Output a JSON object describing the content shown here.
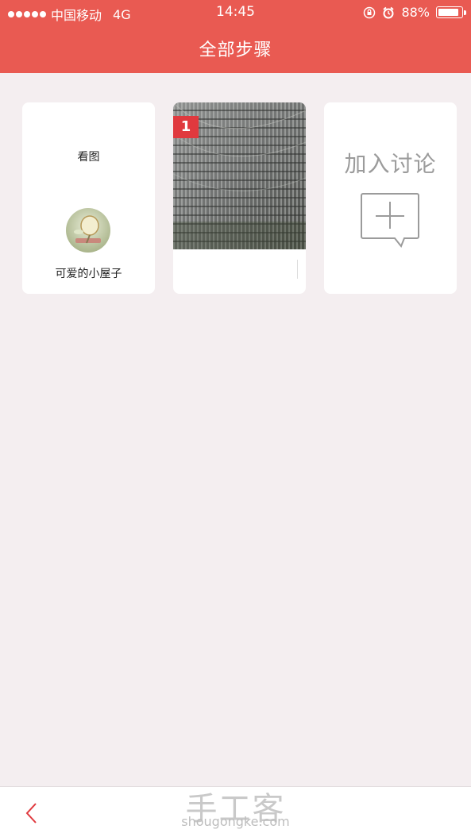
{
  "status_bar": {
    "carrier": "中国移动",
    "network": "4G",
    "time": "14:45",
    "battery_text": "88%",
    "battery_level": 0.88
  },
  "header": {
    "title": "全部步骤",
    "background_color": "#e95a52"
  },
  "cards": {
    "author": {
      "label": "看图",
      "name": "可爱的小屋子"
    },
    "step": {
      "number": "1",
      "badge_color": "#e0393e"
    },
    "discuss": {
      "label": "加入讨论",
      "icon": "comment-add-icon"
    }
  },
  "bottom_bar": {
    "back_icon": "chevron-left-icon",
    "watermark": "手工客",
    "watermark_url": "shougongke.com"
  }
}
